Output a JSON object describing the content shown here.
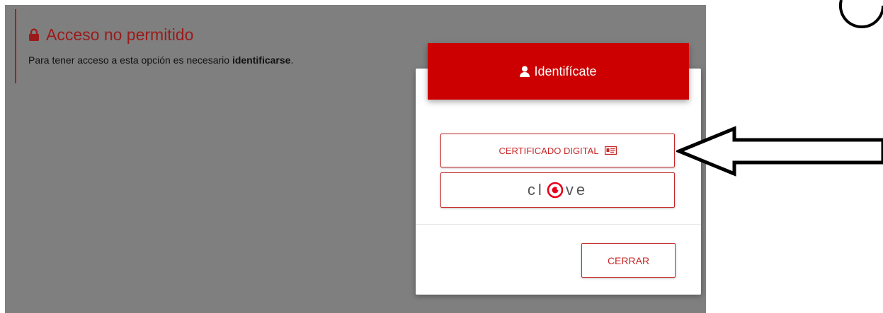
{
  "alert": {
    "title": "Acceso no permitido",
    "text_prefix": "Para tener acceso a esta opción es necesario ",
    "text_bold": "identificarse",
    "text_suffix": ".",
    "lock_icon": "lock-icon"
  },
  "modal": {
    "title": "Identifícate",
    "user_icon": "user-icon",
    "buttons": {
      "certificado": "CERTIFICADO DIGITAL",
      "clave_logo": "clave",
      "cerrar": "CERRAR"
    }
  },
  "colors": {
    "accent": "#cc0000",
    "button_text": "#c62828",
    "overlay": "#7f7f7f",
    "alert_title": "#9c1a1a"
  }
}
